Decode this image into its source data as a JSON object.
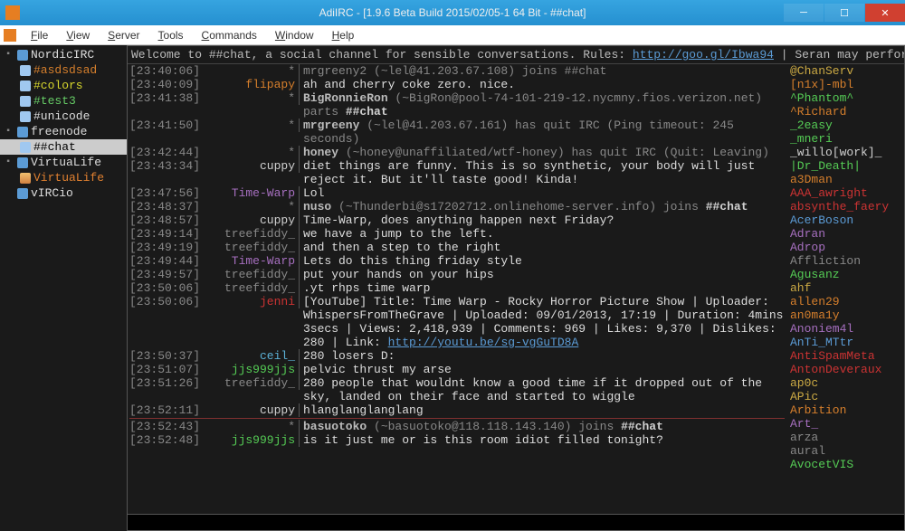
{
  "window": {
    "title": "AdiIRC - [1.9.6 Beta Build 2015/02/05-1 64 Bit - ##chat]"
  },
  "menu": [
    "File",
    "View",
    "Server",
    "Tools",
    "Commands",
    "Window",
    "Help"
  ],
  "tree": {
    "servers": [
      {
        "name": "NordicIRC",
        "channels": [
          {
            "label": "#asdsdsad",
            "color": "#d67f2c"
          },
          {
            "label": "#colors",
            "color": "#d6d62c"
          },
          {
            "label": "#test3",
            "color": "#66cc66"
          },
          {
            "label": "#unicode",
            "color": "#ddd"
          }
        ]
      },
      {
        "name": "freenode",
        "channels": [
          {
            "label": "##chat",
            "color": "#000",
            "selected": true
          }
        ]
      },
      {
        "name": "VirtuaLife",
        "channels": [
          {
            "label": "VirtuaLife",
            "color": "#e08030",
            "icon": "person"
          }
        ]
      },
      {
        "name": "vIRCio",
        "channels": []
      }
    ]
  },
  "topic": {
    "prefix": "Welcome to ##chat, a social channel for sensible conversations. Rules: ",
    "link": "http://goo.gl/Ibwa94",
    "suffix": " | Seran may perform a"
  },
  "chat": [
    {
      "ts": "23:40:06",
      "nick": "*",
      "nickColor": "#888",
      "kind": "dim",
      "msg": "mrgreeny2 (~lel@41.203.67.108) joins ##chat"
    },
    {
      "ts": "23:40:09",
      "nick": "flipapy",
      "nickColor": "#d67f2c",
      "msg": "ah and cherry coke zero. nice."
    },
    {
      "ts": "23:41:38",
      "nick": "*",
      "nickColor": "#888",
      "kind": "dim",
      "msg": "BigRonnieRon (~BigRon@pool-74-101-219-12.nycmny.fios.verizon.net) parts ##chat",
      "boldFirst": "BigRonnieRon",
      "chanEnd": "##chat"
    },
    {
      "ts": "23:41:50",
      "nick": "*",
      "nickColor": "#888",
      "kind": "dim",
      "msg": "mrgreeny (~lel@41.203.67.161) has quit IRC (Ping timeout: 245 seconds)",
      "boldFirst": "mrgreeny"
    },
    {
      "ts": "23:42:44",
      "nick": "*",
      "nickColor": "#888",
      "kind": "dim",
      "msg": "honey (~honey@unaffiliated/wtf-honey) has quit IRC (Quit: Leaving)",
      "boldFirst": "honey"
    },
    {
      "ts": "23:43:34",
      "nick": "cuppy",
      "nickColor": "#d0d0d0",
      "msg": "diet things are funny. This is so synthetic, your body will just reject it. But it'll taste good! Kinda!"
    },
    {
      "ts": "23:47:56",
      "nick": "Time-Warp",
      "nickColor": "#a66fbf",
      "msg": "Lol"
    },
    {
      "ts": "23:48:37",
      "nick": "*",
      "nickColor": "#888",
      "kind": "dim",
      "msg": "nuso (~Thunderbi@s17202712.onlinehome-server.info) joins ##chat",
      "boldFirst": "nuso",
      "chanEnd": "##chat"
    },
    {
      "ts": "23:48:57",
      "nick": "cuppy",
      "nickColor": "#d0d0d0",
      "msg": "Time-Warp, does anything happen next Friday?"
    },
    {
      "ts": "23:49:14",
      "nick": "treefiddy_",
      "nickColor": "#888",
      "msg": "we have a jump to the left."
    },
    {
      "ts": "23:49:19",
      "nick": "treefiddy_",
      "nickColor": "#888",
      "msg": "and then a step to the right"
    },
    {
      "ts": "23:49:44",
      "nick": "Time-Warp",
      "nickColor": "#a66fbf",
      "msg": "Lets do this thing friday style"
    },
    {
      "ts": "23:49:57",
      "nick": "treefiddy_",
      "nickColor": "#888",
      "msg": "put your hands on your hips"
    },
    {
      "ts": "23:50:06",
      "nick": "treefiddy_",
      "nickColor": "#888",
      "msg": ".yt rhps time warp"
    },
    {
      "ts": "23:50:06",
      "nick": "jenni",
      "nickColor": "#cc3333",
      "msg": "[YouTube] Title: Time Warp - Rocky Horror Picture Show | Uploader: WhispersFromTheGrave | Uploaded: 09/01/2013, 17:19 | Duration: 4mins 3secs | Views: 2,418,939 | Comments: 969 | Likes: 9,370 | Dislikes: 280 | Link: ",
      "link": "http://youtu.be/sg-vgGuTD8A"
    },
    {
      "ts": "23:50:37",
      "nick": "ceil_",
      "nickColor": "#5bb0d5",
      "msg": "280 losers D:"
    },
    {
      "ts": "23:51:07",
      "nick": "jjs999jjs",
      "nickColor": "#55cc55",
      "msg": "pelvic thrust my arse"
    },
    {
      "ts": "23:51:26",
      "nick": "treefiddy_",
      "nickColor": "#888",
      "msg": "280 people that wouldnt know a good time if it dropped out of the sky, landed on their face and started to wiggle"
    },
    {
      "ts": "23:52:11",
      "nick": "cuppy",
      "nickColor": "#d0d0d0",
      "msg": "hlanglanglanglang"
    },
    {
      "divider": true
    },
    {
      "ts": "23:52:43",
      "nick": "*",
      "nickColor": "#888",
      "kind": "dim",
      "msg": "basuotoko (~basuotoko@118.118.143.140) joins ##chat",
      "boldFirst": "basuotoko",
      "chanEnd": "##chat"
    },
    {
      "ts": "23:52:48",
      "nick": "jjs999jjs",
      "nickColor": "#55cc55",
      "msg": "is it just me or is this room idiot filled tonight?"
    }
  ],
  "nicklist": [
    {
      "name": "@ChanServ",
      "color": "#ccaa44"
    },
    {
      "name": "[n1x]-mbl",
      "color": "#d67f2c"
    },
    {
      "name": "^Phantom^",
      "color": "#55cc55"
    },
    {
      "name": "^Richard",
      "color": "#d67f2c"
    },
    {
      "name": "_2easy",
      "color": "#55cc55"
    },
    {
      "name": "_mneri",
      "color": "#55cc55"
    },
    {
      "name": "_willo[work]_",
      "color": "#d0d0d0"
    },
    {
      "name": "|Dr_Death|",
      "color": "#55cc55"
    },
    {
      "name": "a3Dman",
      "color": "#d67f2c"
    },
    {
      "name": "AAA_awright",
      "color": "#cc3333"
    },
    {
      "name": "absynthe_faery",
      "color": "#cc3333"
    },
    {
      "name": "AcerBoson",
      "color": "#5b9bd5"
    },
    {
      "name": "Adran",
      "color": "#a66fbf"
    },
    {
      "name": "Adrop",
      "color": "#a66fbf"
    },
    {
      "name": "Affliction",
      "color": "#888"
    },
    {
      "name": "Agusanz",
      "color": "#55cc55"
    },
    {
      "name": "ahf",
      "color": "#ccaa44"
    },
    {
      "name": "allen29",
      "color": "#d67f2c"
    },
    {
      "name": "an0ma1y",
      "color": "#d67f2c"
    },
    {
      "name": "Anoniem4l",
      "color": "#a66fbf"
    },
    {
      "name": "AnTi_MTtr",
      "color": "#5b9bd5"
    },
    {
      "name": "AntiSpamMeta",
      "color": "#cc3333"
    },
    {
      "name": "AntonDeveraux",
      "color": "#cc3333"
    },
    {
      "name": "ap0c",
      "color": "#ccaa44"
    },
    {
      "name": "APic",
      "color": "#ccaa44"
    },
    {
      "name": "Arbition",
      "color": "#d67f2c"
    },
    {
      "name": "Art_",
      "color": "#a66fbf"
    },
    {
      "name": "arza",
      "color": "#888"
    },
    {
      "name": "aural",
      "color": "#888"
    },
    {
      "name": "AvocetVIS",
      "color": "#55cc55"
    }
  ]
}
